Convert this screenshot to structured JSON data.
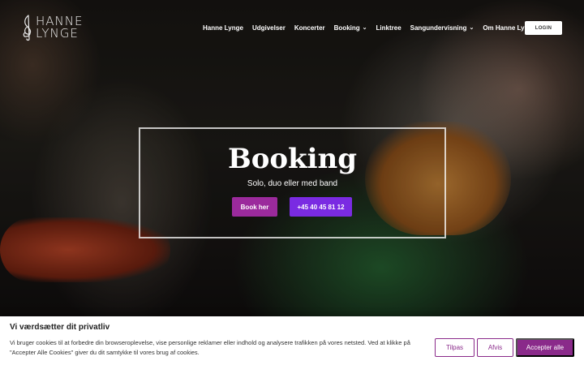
{
  "header": {
    "logo": {
      "line1": "HANNE",
      "line2": "LYNGE",
      "icon": "treble-clef-icon"
    },
    "nav": [
      {
        "label": "Hanne Lynge",
        "dropdown": false
      },
      {
        "label": "Udgivelser",
        "dropdown": false
      },
      {
        "label": "Koncerter",
        "dropdown": false
      },
      {
        "label": "Booking",
        "dropdown": true
      },
      {
        "label": "Linktree",
        "dropdown": false
      },
      {
        "label": "Sangundervisning",
        "dropdown": true
      },
      {
        "label": "Om Hanne Lynge",
        "dropdown": false
      }
    ],
    "login_label": "LOGIN"
  },
  "hero": {
    "title": "Booking",
    "subtitle": "Solo, duo eller med band",
    "book_button": "Book her",
    "phone_button": "+45 40 45 81 12"
  },
  "cookie_banner": {
    "title": "Vi værdsætter dit privatliv",
    "text": "Vi bruger cookies til at forbedre din browseroplevelse, vise personlige reklamer eller indhold og analysere trafikken på vores netsted. Ved at klikke på \"Accepter Alle Cookies\" giver du dit samtykke til vores brug af cookies.",
    "customize_label": "Tilpas",
    "reject_label": "Afvis",
    "accept_label": "Accepter alle"
  },
  "colors": {
    "accent_purple": "#9b2a9c",
    "accent_violet": "#7a2be2",
    "cookie_accent": "#8a2a8a"
  }
}
